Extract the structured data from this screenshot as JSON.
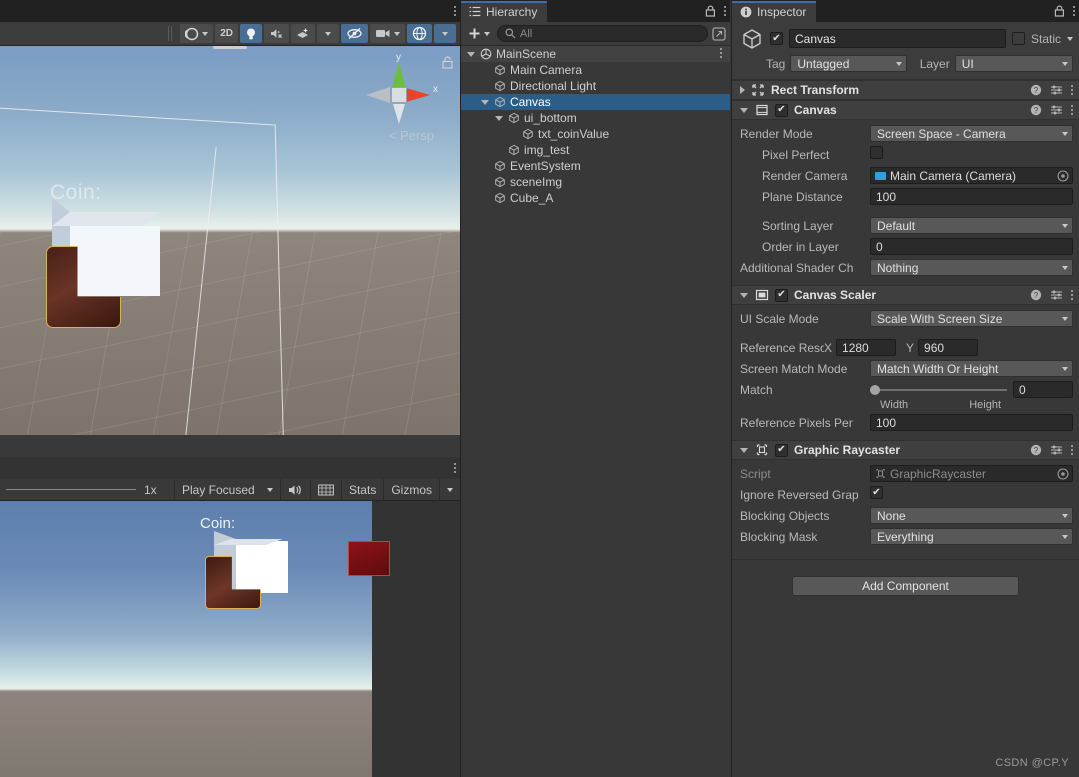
{
  "scene_view": {
    "tab_label": "",
    "toolbar_buttons": [
      {
        "name": "shading-mode",
        "label": "",
        "icon": "sphere-icon",
        "active": false,
        "has_caret": true
      },
      {
        "name": "2d-toggle",
        "label": "2D",
        "icon": "",
        "active": false,
        "has_caret": false
      },
      {
        "name": "lighting-toggle",
        "label": "",
        "icon": "bulb-icon",
        "active": true,
        "has_caret": false
      },
      {
        "name": "audio-toggle",
        "label": "",
        "icon": "mute-icon",
        "active": false,
        "has_caret": false
      },
      {
        "name": "fx-toggle",
        "label": "",
        "icon": "fx-icon",
        "active": false,
        "has_caret": true
      },
      {
        "name": "hidden-objects-toggle",
        "label": "",
        "icon": "eye-off-icon",
        "active": true,
        "has_caret": false
      },
      {
        "name": "camera-settings",
        "label": "",
        "icon": "camera-icon",
        "active": false,
        "has_caret": true
      },
      {
        "name": "gizmos-toggle",
        "label": "",
        "icon": "gizmo-globe-icon",
        "active": true,
        "has_caret": true
      }
    ],
    "overlay_text": "Coin:",
    "perspective_label": "Persp",
    "axis_y": "y",
    "axis_x": "x"
  },
  "game_view": {
    "zoom_label": "1x",
    "play_mode": "Play Focused",
    "stats_label": "Stats",
    "gizmos_label": "Gizmos",
    "overlay_text": "Coin:"
  },
  "hierarchy": {
    "tab_label": "Hierarchy",
    "search_placeholder": "All",
    "add_label": "+",
    "tree": [
      {
        "label": "MainScene",
        "depth": 0,
        "type": "scene",
        "expanded": true,
        "selected": false
      },
      {
        "label": "Main Camera",
        "depth": 1,
        "type": "gameobject",
        "expanded": null,
        "selected": false
      },
      {
        "label": "Directional Light",
        "depth": 1,
        "type": "gameobject",
        "expanded": null,
        "selected": false
      },
      {
        "label": "Canvas",
        "depth": 1,
        "type": "gameobject",
        "expanded": true,
        "selected": true
      },
      {
        "label": "ui_bottom",
        "depth": 2,
        "type": "gameobject",
        "expanded": true,
        "selected": false
      },
      {
        "label": "txt_coinValue",
        "depth": 3,
        "type": "gameobject",
        "expanded": null,
        "selected": false
      },
      {
        "label": "img_test",
        "depth": 2,
        "type": "gameobject",
        "expanded": null,
        "selected": false
      },
      {
        "label": "EventSystem",
        "depth": 1,
        "type": "gameobject",
        "expanded": null,
        "selected": false
      },
      {
        "label": "sceneImg",
        "depth": 1,
        "type": "gameobject",
        "expanded": null,
        "selected": false
      },
      {
        "label": "Cube_A",
        "depth": 1,
        "type": "gameobject",
        "expanded": null,
        "selected": false
      }
    ]
  },
  "inspector": {
    "tab_label": "Inspector",
    "object_name": "Canvas",
    "object_enabled": true,
    "static_label": "Static",
    "static_checked": false,
    "tag_label": "Tag",
    "tag_value": "Untagged",
    "layer_label": "Layer",
    "layer_value": "UI",
    "components": [
      {
        "name": "Rect Transform",
        "expanded": false,
        "has_toggle": false,
        "enabled": null,
        "icon": "rect-transform-icon",
        "properties": []
      },
      {
        "name": "Canvas",
        "expanded": true,
        "has_toggle": true,
        "enabled": true,
        "icon": "canvas-icon",
        "properties": [
          {
            "label": "Render Mode",
            "value": "Screen Space - Camera",
            "type": "dropdown",
            "indent": 0
          },
          {
            "label": "Pixel Perfect",
            "value": "",
            "type": "checkbox",
            "checked": false,
            "indent": 1
          },
          {
            "label": "Render Camera",
            "value": "Main Camera (Camera)",
            "type": "objectfield",
            "indent": 1
          },
          {
            "label": "Plane Distance",
            "value": "100",
            "type": "textfield",
            "indent": 1
          },
          {
            "label": "",
            "value": "",
            "type": "spacer",
            "indent": 0
          },
          {
            "label": "Sorting Layer",
            "value": "Default",
            "type": "dropdown",
            "indent": 1
          },
          {
            "label": "Order in Layer",
            "value": "0",
            "type": "textfield",
            "indent": 1
          },
          {
            "label": "Additional Shader Ch",
            "value": "Nothing",
            "type": "dropdown",
            "indent": 0
          }
        ]
      },
      {
        "name": "Canvas Scaler",
        "expanded": true,
        "has_toggle": true,
        "enabled": true,
        "icon": "canvas-scaler-icon",
        "properties": [
          {
            "label": "UI Scale Mode",
            "value": "Scale With Screen Size",
            "type": "dropdown",
            "indent": 0
          },
          {
            "label": "",
            "value": "",
            "type": "spacer",
            "indent": 0
          },
          {
            "label": "Reference Resolution",
            "value": "",
            "type": "xy",
            "x_label": "X",
            "x_value": "1280",
            "y_label": "Y",
            "y_value": "960",
            "indent": 0
          },
          {
            "label": "Screen Match Mode",
            "value": "Match Width Or Height",
            "type": "dropdown",
            "indent": 0
          },
          {
            "label": "Match",
            "value": "0",
            "type": "slider",
            "slider_pct": 0,
            "left_label": "Width",
            "right_label": "Height",
            "indent": 0
          },
          {
            "label": "Reference Pixels Per",
            "value": "100",
            "type": "textfield",
            "indent": 0
          }
        ]
      },
      {
        "name": "Graphic Raycaster",
        "expanded": true,
        "has_toggle": true,
        "enabled": true,
        "icon": "graphic-raycaster-icon",
        "properties": [
          {
            "label": "Script",
            "value": "GraphicRaycaster",
            "type": "objectfield",
            "dim": true,
            "indent": 0
          },
          {
            "label": "Ignore Reversed Grap",
            "value": "",
            "type": "checkbox",
            "checked": true,
            "indent": 0
          },
          {
            "label": "Blocking Objects",
            "value": "None",
            "type": "dropdown",
            "indent": 0
          },
          {
            "label": "Blocking Mask",
            "value": "Everything",
            "type": "dropdown",
            "indent": 0
          }
        ]
      }
    ],
    "add_component_label": "Add Component"
  },
  "watermark": "CSDN @CP.Y",
  "colors": {
    "accent_blue": "#4a6e93",
    "selection_blue": "#2c5d87",
    "panel_bg": "#383838",
    "header_bg": "#3c3c3c"
  }
}
